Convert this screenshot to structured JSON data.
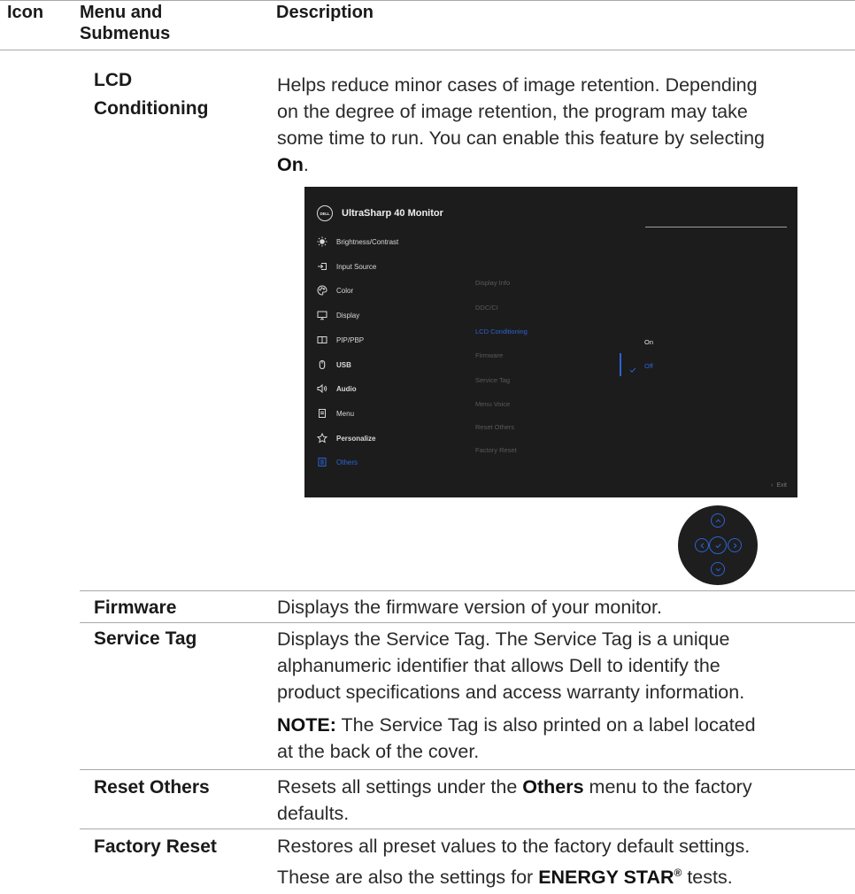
{
  "header": {
    "icon": "Icon",
    "menu_line1": "Menu and",
    "menu_line2": "Submenus",
    "description": "Description"
  },
  "rows": {
    "lcd": {
      "name_line1": "LCD",
      "name_line2": "Conditioning",
      "desc_lines": [
        "Helps reduce minor cases of image retention. Depending",
        "on the degree of image retention, the program may take",
        "some time to run. You can enable this feature by selecting"
      ],
      "desc_bold": "On",
      "desc_end": "."
    },
    "firmware": {
      "name": "Firmware",
      "desc": "Displays the firmware version of your monitor."
    },
    "service_tag": {
      "name": "Service Tag",
      "desc_lines": [
        "Displays the Service Tag. The Service Tag is a unique",
        "alphanumeric identifier that allows Dell to identify the",
        "product specifications and access warranty information."
      ],
      "note_label": "NOTE:",
      "note_line1": " The Service Tag is also printed on a label located",
      "note_line2": "at the back of the cover."
    },
    "reset_others": {
      "name": "Reset Others",
      "desc_pre": "Resets all settings under the ",
      "desc_bold": "Others",
      "desc_post": " menu to the factory",
      "desc_line2": "defaults."
    },
    "factory_reset": {
      "name": "Factory Reset",
      "desc_line1": "Restores all preset values to the factory default settings.",
      "desc_pre": "These are also the settings for ",
      "desc_bold": "ENERGY STAR",
      "desc_sup": "®",
      "desc_post": " tests."
    }
  },
  "osd": {
    "logo": "DELL",
    "title": "UltraSharp 40 Monitor",
    "menu": [
      {
        "label": "Brightness/Contrast",
        "icon": "brightness-icon"
      },
      {
        "label": "Input Source",
        "icon": "input-source-icon"
      },
      {
        "label": "Color",
        "icon": "color-palette-icon"
      },
      {
        "label": "Display",
        "icon": "display-icon"
      },
      {
        "label": "PIP/PBP",
        "icon": "pip-pbp-icon"
      },
      {
        "label": "USB",
        "icon": "usb-mouse-icon"
      },
      {
        "label": "Audio",
        "icon": "speaker-icon"
      },
      {
        "label": "Menu",
        "icon": "menu-icon"
      },
      {
        "label": "Personalize",
        "icon": "star-icon"
      },
      {
        "label": "Others",
        "icon": "others-icon"
      }
    ],
    "submenu": [
      "Display Info",
      "DDC/CI",
      "LCD Conditioning",
      "Firmware",
      "Service Tag",
      "Menu Voice",
      "Reset Others",
      "Factory Reset"
    ],
    "options": {
      "on": "On",
      "off": "Off"
    },
    "exit_label": "Exit",
    "accent_color": "#2b64d4"
  },
  "joystick": {
    "buttons": [
      "up-arrow-icon",
      "left-arrow-icon",
      "check-icon",
      "right-arrow-icon",
      "down-arrow-icon"
    ]
  }
}
